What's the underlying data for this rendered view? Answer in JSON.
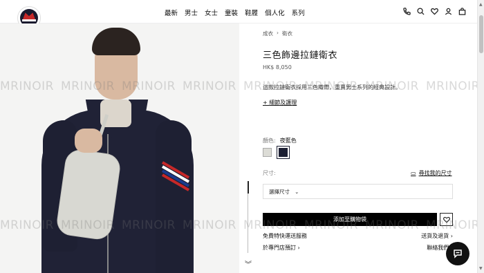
{
  "header": {
    "brand": "MONCLER",
    "nav": [
      "最新",
      "男士",
      "女士",
      "童裝",
      "鞋履",
      "個人化",
      "系列"
    ],
    "icons": [
      "phone-icon",
      "search-icon",
      "heart-icon",
      "user-icon",
      "bag-icon"
    ]
  },
  "watermark": {
    "text": "MRINOIR"
  },
  "breadcrumb": {
    "parent": "成衣",
    "current": "衛衣"
  },
  "product": {
    "title": "三色飾邊拉鏈衛衣",
    "price": "HK$ 8,050",
    "description": "這款拉鏈衛衣採用三色織帶，重賣男士系列的經典設計。",
    "details_link": "細節及護理"
  },
  "color": {
    "label": "顏色:",
    "selected": "夜藍色",
    "swatches": [
      {
        "name": "light-grey",
        "hex": "#dcdcd6"
      },
      {
        "name": "night-blue",
        "hex": "#1c1f33"
      }
    ]
  },
  "size": {
    "label": "尺寸:",
    "guide_link": "尋找我的尺寸",
    "select_placeholder": "選擇尺寸"
  },
  "actions": {
    "add_to_bag": "添加至購物袋",
    "free_shipping": "免費特快運送服務",
    "shipping_returns": "送貨及退貨",
    "book_in_store": "於專門店預訂",
    "contact_us": "聯絡我們"
  },
  "colors": {
    "accent": "#000000",
    "stripe_red": "#c62828",
    "stripe_blue": "#1a3a8c"
  }
}
